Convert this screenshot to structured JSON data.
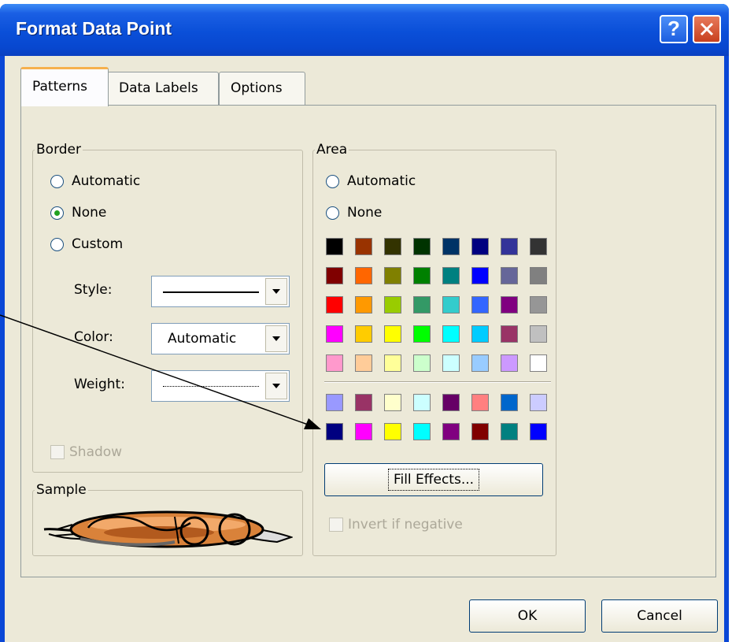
{
  "window": {
    "title": "Format Data Point"
  },
  "titlebar_buttons": {
    "help": "?"
  },
  "tabs": [
    {
      "label": "Patterns"
    },
    {
      "label": "Data Labels"
    },
    {
      "label": "Options"
    }
  ],
  "border": {
    "legend": "Border",
    "radios": [
      {
        "label": "Automatic",
        "checked": false
      },
      {
        "label": "None",
        "checked": true
      },
      {
        "label": "Custom",
        "checked": false
      }
    ],
    "style_label": "Style:",
    "color_label": "Color:",
    "color_value": "Automatic",
    "weight_label": "Weight:",
    "shadow_label": "Shadow"
  },
  "area": {
    "legend": "Area",
    "radios": [
      {
        "label": "Automatic",
        "checked": false
      },
      {
        "label": "None",
        "checked": false
      }
    ],
    "palette_main": [
      "#000000",
      "#993300",
      "#333300",
      "#003300",
      "#003366",
      "#000080",
      "#333399",
      "#333333",
      "#800000",
      "#FF6600",
      "#808000",
      "#008000",
      "#008080",
      "#0000FF",
      "#666699",
      "#808080",
      "#FF0000",
      "#FF9900",
      "#99CC00",
      "#339966",
      "#33CCCC",
      "#3366FF",
      "#800080",
      "#969696",
      "#FF00FF",
      "#FFCC00",
      "#FFFF00",
      "#00FF00",
      "#00FFFF",
      "#00CCFF",
      "#993366",
      "#C0C0C0",
      "#FF99CC",
      "#FFCC99",
      "#FFFF99",
      "#CCFFCC",
      "#CCFFFF",
      "#99CCFF",
      "#CC99FF",
      "#FFFFFF"
    ],
    "palette_chart": [
      "#9999FF",
      "#993366",
      "#FFFFCC",
      "#CCFFFF",
      "#660066",
      "#FF8080",
      "#0066CC",
      "#CCCCFF",
      "#000080",
      "#FF00FF",
      "#FFFF00",
      "#00FFFF",
      "#800080",
      "#800000",
      "#008080",
      "#0000FF"
    ],
    "fill_effects_label": "Fill Effects...",
    "invert_label": "Invert if negative"
  },
  "sample": {
    "legend": "Sample"
  },
  "buttons": {
    "ok": "OK",
    "cancel": "Cancel"
  }
}
